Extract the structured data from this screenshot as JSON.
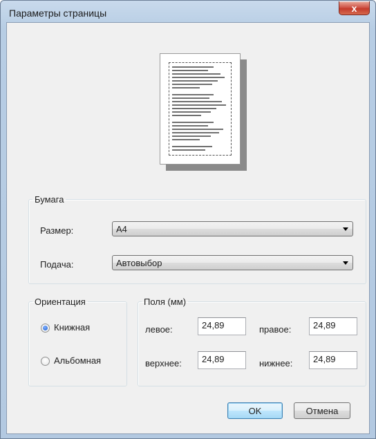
{
  "window": {
    "title": "Параметры страницы",
    "close_label": "x"
  },
  "paper": {
    "group_label": "Бумага",
    "size_label": "Размер:",
    "size_value": "A4",
    "source_label": "Подача:",
    "source_value": "Автовыбор"
  },
  "orientation": {
    "group_label": "Ориентация",
    "portrait_label": "Книжная",
    "landscape_label": "Альбомная",
    "selected": "portrait"
  },
  "margins": {
    "group_label": "Поля (мм)",
    "left_label": "левое:",
    "left_value": "24,89",
    "right_label": "правое:",
    "right_value": "24,89",
    "top_label": "верхнее:",
    "top_value": "24,89",
    "bottom_label": "нижнее:",
    "bottom_value": "24,89"
  },
  "buttons": {
    "ok_label": "OK",
    "cancel_label": "Отмена"
  }
}
